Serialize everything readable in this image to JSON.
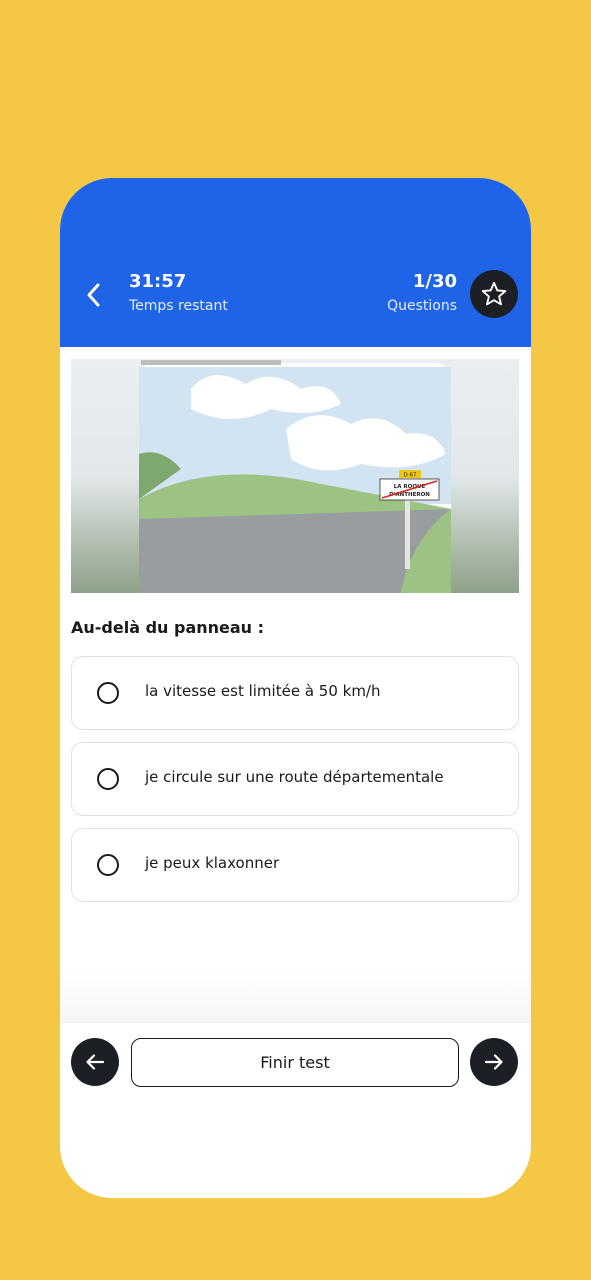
{
  "header": {
    "timer_value": "31:57",
    "timer_label": "Temps restant",
    "question_count": "1/30",
    "question_label": "Questions"
  },
  "image": {
    "sign_route": "D 67",
    "sign_town_line1": "LA ROQUE",
    "sign_town_line2": "D'ANTHERON"
  },
  "question": {
    "text": "Au-delà du panneau :"
  },
  "options": [
    {
      "label": "la vitesse est limitée à 50 km/h",
      "selected": false
    },
    {
      "label": "je circule sur une route départementale",
      "selected": false
    },
    {
      "label": "je peux klaxonner",
      "selected": false
    }
  ],
  "footer": {
    "finish_label": "Finir test"
  },
  "colors": {
    "background": "#F4C844",
    "header": "#1F63E6",
    "dark_button": "#1C1F26"
  }
}
